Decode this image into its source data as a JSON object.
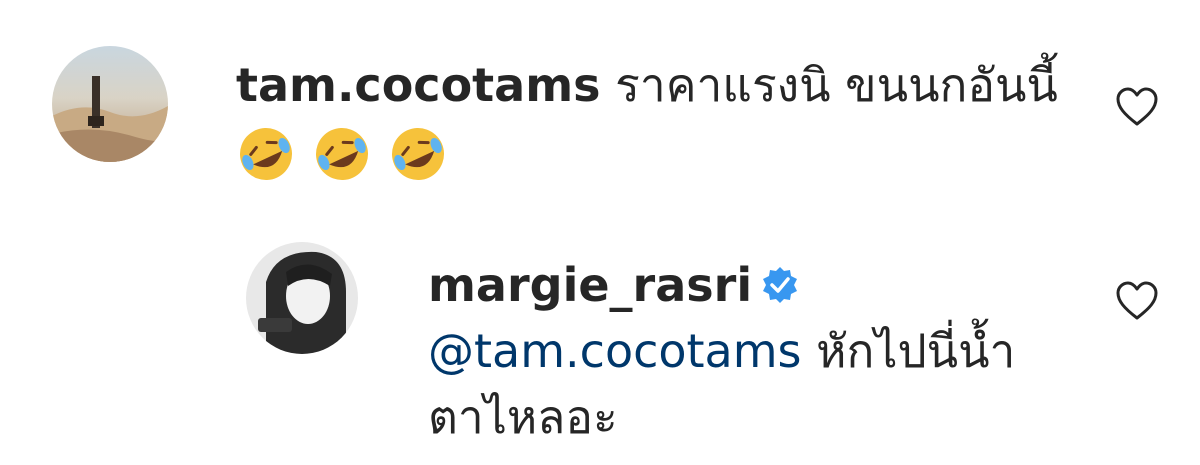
{
  "comments": [
    {
      "username": "tam.cocotams",
      "text": " ราคาแรงนิ ขนนกอันนี้",
      "emojis": [
        "rolling-on-floor-laughing-emoji",
        "rolling-on-floor-laughing-emoji",
        "rolling-on-floor-laughing-emoji"
      ],
      "avatar_icon": "avatar-photo",
      "like_icon": "heart-outline-icon"
    },
    {
      "username": "margie_rasri",
      "verified": true,
      "verified_icon": "verified-badge-icon",
      "mention": "@tam.cocotams",
      "text_line1": " หักไปนี่น้ำ",
      "text_line2": "ตาไหลอะ",
      "avatar_icon": "avatar-photo",
      "like_icon": "heart-outline-icon"
    }
  ],
  "colors": {
    "text": "#262626",
    "mention": "#00376b",
    "verified": "#3897f0",
    "heart_stroke": "#262626"
  }
}
